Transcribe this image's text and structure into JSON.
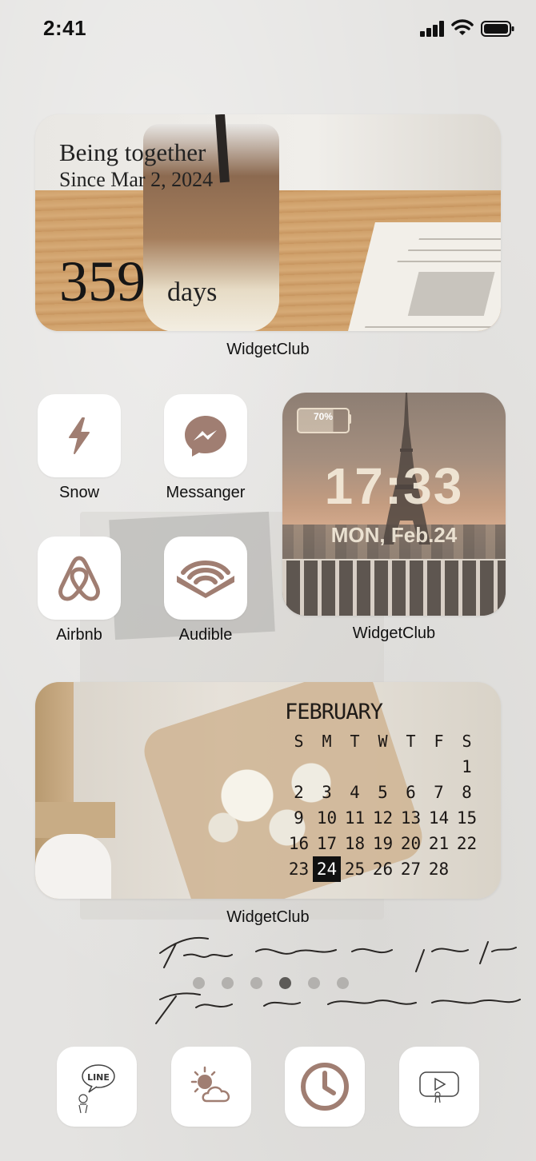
{
  "status_bar": {
    "time": "2:41"
  },
  "top_widget": {
    "title": "Being together",
    "since": "Since Mar 2, 2024",
    "days_count": "359",
    "days_unit": "days",
    "caption": "WidgetClub"
  },
  "apps": [
    {
      "label": "Snow",
      "icon": "lightning-icon"
    },
    {
      "label": "Messanger",
      "icon": "messenger-icon"
    },
    {
      "label": "Airbnb",
      "icon": "airbnb-icon"
    },
    {
      "label": "Audible",
      "icon": "audible-icon"
    }
  ],
  "paris_widget": {
    "battery": "70%",
    "battery_level": 0.7,
    "time": "17:33",
    "date": "MON, Feb.24",
    "caption": "WidgetClub"
  },
  "calendar_widget": {
    "month": "FEBRUARY",
    "weekdays": [
      "S",
      "M",
      "T",
      "W",
      "T",
      "F",
      "S"
    ],
    "weeks": [
      [
        "",
        "",
        "",
        "",
        "",
        "",
        "1"
      ],
      [
        "2",
        "3",
        "4",
        "5",
        "6",
        "7",
        "8"
      ],
      [
        "9",
        "10",
        "11",
        "12",
        "13",
        "14",
        "15"
      ],
      [
        "16",
        "17",
        "18",
        "19",
        "20",
        "21",
        "22"
      ],
      [
        "23",
        "24",
        "25",
        "26",
        "27",
        "28",
        ""
      ]
    ],
    "today": "24",
    "caption": "WidgetClub"
  },
  "page_dots": {
    "count": 6,
    "active_index": 3
  },
  "dock": [
    {
      "icon": "line-icon",
      "label": "LINE"
    },
    {
      "icon": "weather-icon"
    },
    {
      "icon": "clock-icon"
    },
    {
      "icon": "youtube-icon"
    }
  ],
  "accent_color": "#a07e72"
}
